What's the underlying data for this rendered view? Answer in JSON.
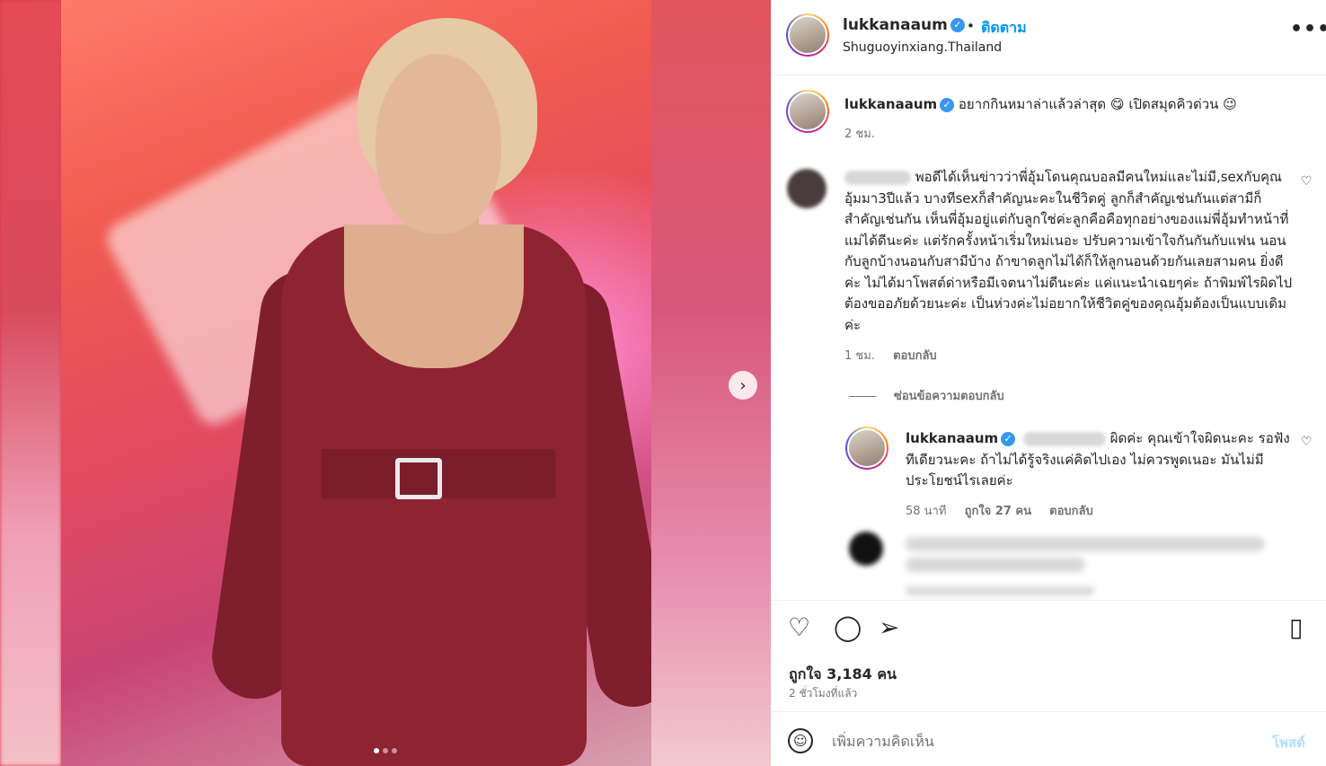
{
  "post": {
    "username": "lukkanaaum",
    "follow_label": "ติดตาม",
    "dot": "•",
    "location": "Shuguoyinxiang.Thailand",
    "more": "•••"
  },
  "caption": {
    "username": "lukkanaaum",
    "text": "อยากกินหมาล่าแล้วล่าสุด 😋 เปิดสมุดคิวด่วน 😉",
    "time": "2 ชม."
  },
  "comments": [
    {
      "text": "พอดีได้เห็นข่าวว่าพี่อุ้มโดนคุณบอลมีคนใหม่และไม่มี,sexกับคุณอุ้มมา3ปีแล้ว บางทีsexก็สำคัญนะคะในชีวิตคู่ ลูกก็สำคัญเช่นกันแต่สามีก็สำคัญเช่นกัน เห็นพี่อุ้มอยู่แต่กับลูกใช่ค่ะลูกคือคือทุกอย่างของแม่พี่อุ้มทำหน้าที่แม่ได้ดีนะค่ะ แต่รักครั้งหน้าเริ่มใหม่เนอะ ปรับความเข้าใจกันกันกับแฟน นอนกับลูกบ้างนอนกับสามีบ้าง ถ้าขาดลูกไม่ได้ก็ให้ลูกนอนด้วยกันเลยสามคน ยิ่งดีค่ะ ไม่ได้มาโพสต์ด่าหรือมีเจตนาไม่ดีนะค่ะ แค่แนะนำเฉยๆค่ะ ถ้าพิมพ์ไรผิดไปต้องขออภัยด้วยนะค่ะ เป็นห่วงค่ะไม่อยากให้ชีวิตคู่ของคุณอุ้มต้องเป็นแบบเดิมค่ะ",
      "time": "1 ชม.",
      "reply_label": "ตอบกลับ"
    }
  ],
  "hide_replies": "ซ่อนข้อความตอบกลับ",
  "reply": {
    "username": "lukkanaaum",
    "text": "ผิดค่ะ คุณเข้าใจผิดนะคะ รอฟังทีเดียวนะคะ ถ้าไม่ได้รู้จริงแค่คิดไปเอง ไม่ควรพูดเนอะ มันไม่มีประโยชน์ไรเลยค่ะ",
    "time": "58 นาที",
    "likes": "ถูกใจ 27 คน",
    "reply_label": "ตอบกลับ"
  },
  "actions": {
    "likes": "ถูกใจ 3,184 คน",
    "posted": "2 ชั่วโมงที่แล้ว"
  },
  "add_comment": {
    "placeholder": "เพิ่มความคิดเห็น",
    "post_label": "โพสต์"
  },
  "icons": {
    "heart": "♡",
    "comment": "◯",
    "share": "➢",
    "save": "▯",
    "emoji": "☺",
    "next": "›"
  },
  "colors": {
    "link_blue": "#0095f6",
    "verified_blue": "#3897f0",
    "muted": "#737373"
  }
}
